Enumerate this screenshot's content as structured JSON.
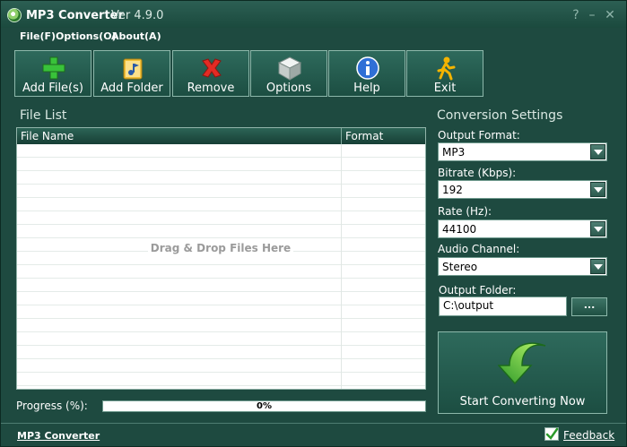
{
  "window": {
    "app_name": "MP3 Converter",
    "version": "Ver 4.9.0",
    "help_glyph": "?",
    "minimize_glyph": "–",
    "close_glyph": "✕"
  },
  "menu": [
    "File(F)",
    "Options(O)",
    "About(A)"
  ],
  "toolbar": [
    {
      "label": "Add File(s)",
      "icon": "plus-icon"
    },
    {
      "label": "Add Folder",
      "icon": "folder-icon"
    },
    {
      "label": "Remove",
      "icon": "remove-x-icon"
    },
    {
      "label": "Options",
      "icon": "cube-icon"
    },
    {
      "label": "Help",
      "icon": "info-icon"
    },
    {
      "label": "Exit",
      "icon": "running-man-icon"
    }
  ],
  "file_list": {
    "title": "File List",
    "col_name": "File Name",
    "col_format": "Format",
    "drop_hint": "Drag & Drop Files Here"
  },
  "progress": {
    "label": "Progress (%):",
    "value_text": "0%",
    "value": 0
  },
  "settings": {
    "title": "Conversion Settings",
    "output_format_label": "Output Format:",
    "output_format": "MP3",
    "bitrate_label": "Bitrate (Kbps):",
    "bitrate": "192",
    "rate_label": "Rate (Hz):",
    "rate": "44100",
    "channel_label": "Audio Channel:",
    "channel": "Stereo",
    "folder_label": "Output Folder:",
    "folder": "C:\\output",
    "browse_label": "...",
    "start_label": "Start Converting Now"
  },
  "status": {
    "app_link": "MP3 Converter",
    "feedback": "Feedback"
  },
  "colors": {
    "accent": "#1e4a40",
    "progress": "#2f8f53"
  }
}
